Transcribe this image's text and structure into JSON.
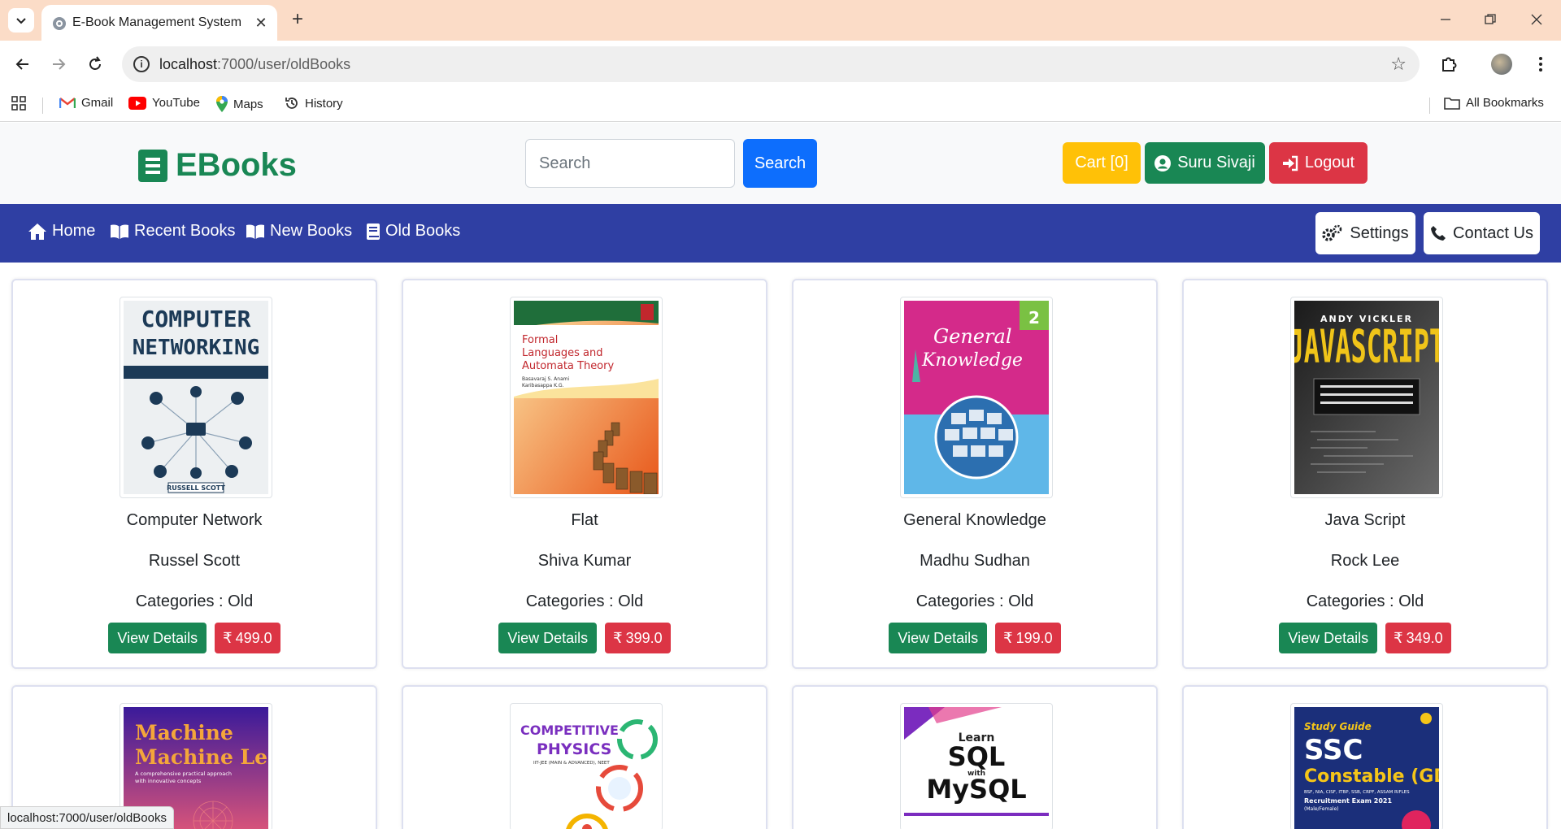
{
  "browser": {
    "tab_title": "E-Book Management System",
    "url_host": "localhost",
    "url_path": ":7000/user/oldBooks",
    "status_url": "localhost:7000/user/oldBooks",
    "bookmarks": [
      {
        "label": "Gmail",
        "icon": "gmail-icon"
      },
      {
        "label": "YouTube",
        "icon": "youtube-icon"
      },
      {
        "label": "Maps",
        "icon": "maps-icon"
      },
      {
        "label": "History",
        "icon": "history-icon"
      }
    ],
    "all_bookmarks": "All Bookmarks"
  },
  "header": {
    "logo_text": "EBooks",
    "search_placeholder": "Search",
    "search_button": "Search",
    "cart_label": "Cart [0]",
    "user_name": "Suru Sivaji",
    "logout_label": "Logout"
  },
  "nav": {
    "links": [
      "Home",
      "Recent Books",
      "New Books",
      "Old Books"
    ],
    "settings": "Settings",
    "contact": "Contact Us"
  },
  "books": [
    {
      "title": "Computer Network",
      "author": "Russel Scott",
      "category": "Categories : Old",
      "view": "View Details",
      "price": "499.0"
    },
    {
      "title": "Flat",
      "author": "Shiva Kumar",
      "category": "Categories : Old",
      "view": "View Details",
      "price": "399.0"
    },
    {
      "title": "General Knowledge",
      "author": "Madhu Sudhan",
      "category": "Categories : Old",
      "view": "View Details",
      "price": "199.0"
    },
    {
      "title": "Java Script",
      "author": "Rock Lee",
      "category": "Categories : Old",
      "view": "View Details",
      "price": "349.0"
    }
  ],
  "covers": {
    "cn_line1": "COMPUTER",
    "cn_line2": "NETWORKING",
    "cn_author": "RUSSELL SCOTT",
    "flat_title": "Formal Languages and Automata Theory",
    "flat_authors": "Basavaraj S. Anami / Karibasappa K.G.",
    "gk_title": "General Knowledge",
    "js_author": "ANDY VICKLER",
    "js_title": "JAVASCRIPT",
    "ml_title": "Machine Learning:",
    "ml_sub": "A comprehensive practical approach with innovative concepts",
    "cp_title": "COMPETITIVE PHYSICS",
    "cp_sub": "IIT-JEE (MAIN & ADVANCED), NEET",
    "sql_line1": "Learn",
    "sql_line2": "SQL",
    "sql_line3": "with",
    "sql_line4": "MySQL",
    "ssc_guide": "Study Guide",
    "ssc_title": "SSC",
    "ssc_sub": "Constable (GD)",
    "ssc_exam": "Recruitment Exam 2021"
  },
  "colors": {
    "brand_green": "#198754",
    "nav_blue": "#2f3fa3",
    "cart_yellow": "#ffc107",
    "danger_red": "#dc3545",
    "primary_blue": "#0d6efd"
  }
}
